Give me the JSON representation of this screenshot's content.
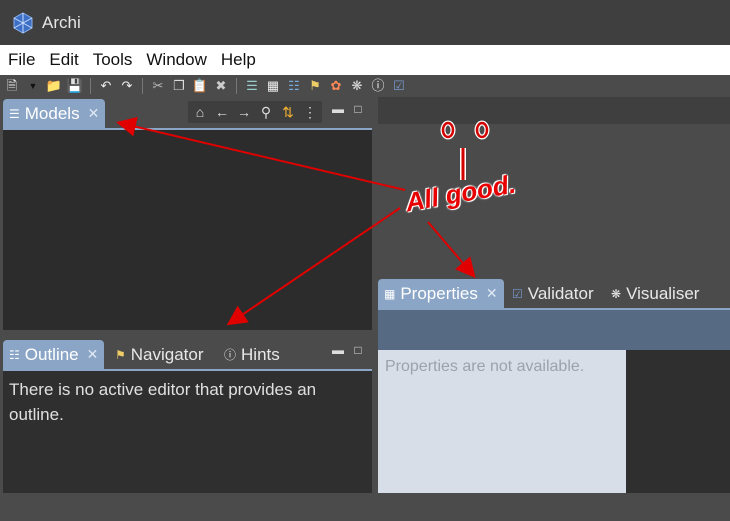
{
  "app": {
    "title": "Archi"
  },
  "menu": [
    "File",
    "Edit",
    "Tools",
    "Window",
    "Help"
  ],
  "models_view": {
    "tab_label": "Models"
  },
  "outline_view": {
    "tabs": {
      "outline": "Outline",
      "navigator": "Navigator",
      "hints": "Hints"
    },
    "message": "There is no active editor that provides an outline."
  },
  "properties_view": {
    "tabs": {
      "properties": "Properties",
      "validator": "Validator",
      "visualiser": "Visualiser"
    },
    "message": "Properties are not available."
  },
  "annotation": {
    "text": "All good.",
    "eyes": "o o",
    "mouth": "|",
    "color": "#e80000"
  },
  "colors": {
    "active_tab": "#8aa5c6",
    "properties_body": "#d7dee7",
    "title_bar": "#3f3f3f"
  }
}
